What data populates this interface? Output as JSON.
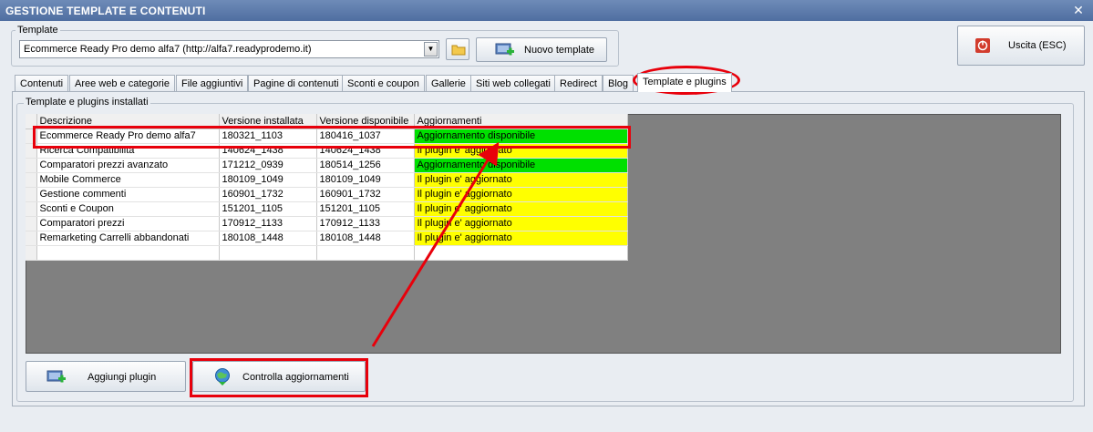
{
  "window": {
    "title": "GESTIONE TEMPLATE E CONTENUTI",
    "close": "✕"
  },
  "template_group": {
    "label": "Template",
    "select_value": "Ecommerce Ready Pro demo alfa7 (http://alfa7.readyprodemo.it)",
    "folder_icon": "folder-icon",
    "new_button": "Nuovo template"
  },
  "exit_button": "Uscita (ESC)",
  "tabs": [
    "Contenuti",
    "Aree web e categorie",
    "File aggiuntivi",
    "Pagine di contenuti",
    "Sconti e coupon",
    "Gallerie",
    "Siti web collegati",
    "Redirect",
    "Blog",
    "Template e plugins"
  ],
  "active_tab": "Template e plugins",
  "installed_group": {
    "label": "Template e plugins installati"
  },
  "table": {
    "headers": [
      "Descrizione",
      "Versione installata",
      "Versione disponibile",
      "Aggiornamenti"
    ],
    "rows": [
      [
        "Ecommerce Ready Pro demo alfa7",
        "180321_1103",
        "180416_1037",
        "Aggiornamento disponibile"
      ],
      [
        "Ricerca Compatibilita",
        "140624_1438",
        "140624_1438",
        "Il plugin e' aggiornato"
      ],
      [
        "Comparatori prezzi avanzato",
        "171212_0939",
        "180514_1256",
        "Aggiornamento disponibile"
      ],
      [
        "Mobile Commerce",
        "180109_1049",
        "180109_1049",
        "Il plugin e' aggiornato"
      ],
      [
        "Gestione commenti",
        "160901_1732",
        "160901_1732",
        "Il plugin e' aggiornato"
      ],
      [
        "Sconti e Coupon",
        "151201_1105",
        "151201_1105",
        "Il plugin e' aggiornato"
      ],
      [
        "Comparatori prezzi",
        "170912_1133",
        "170912_1133",
        "Il plugin e' aggiornato"
      ],
      [
        "Remarketing Carrelli abbandonati",
        "180108_1448",
        "180108_1448",
        "Il plugin e' aggiornato"
      ]
    ],
    "status_colors": {
      "update": "#00e000",
      "ok": "#ffff00"
    }
  },
  "buttons": {
    "add_plugin": "Aggiungi plugin",
    "check_updates": "Controlla aggiornamenti"
  },
  "annotation_color": "#e8000b"
}
